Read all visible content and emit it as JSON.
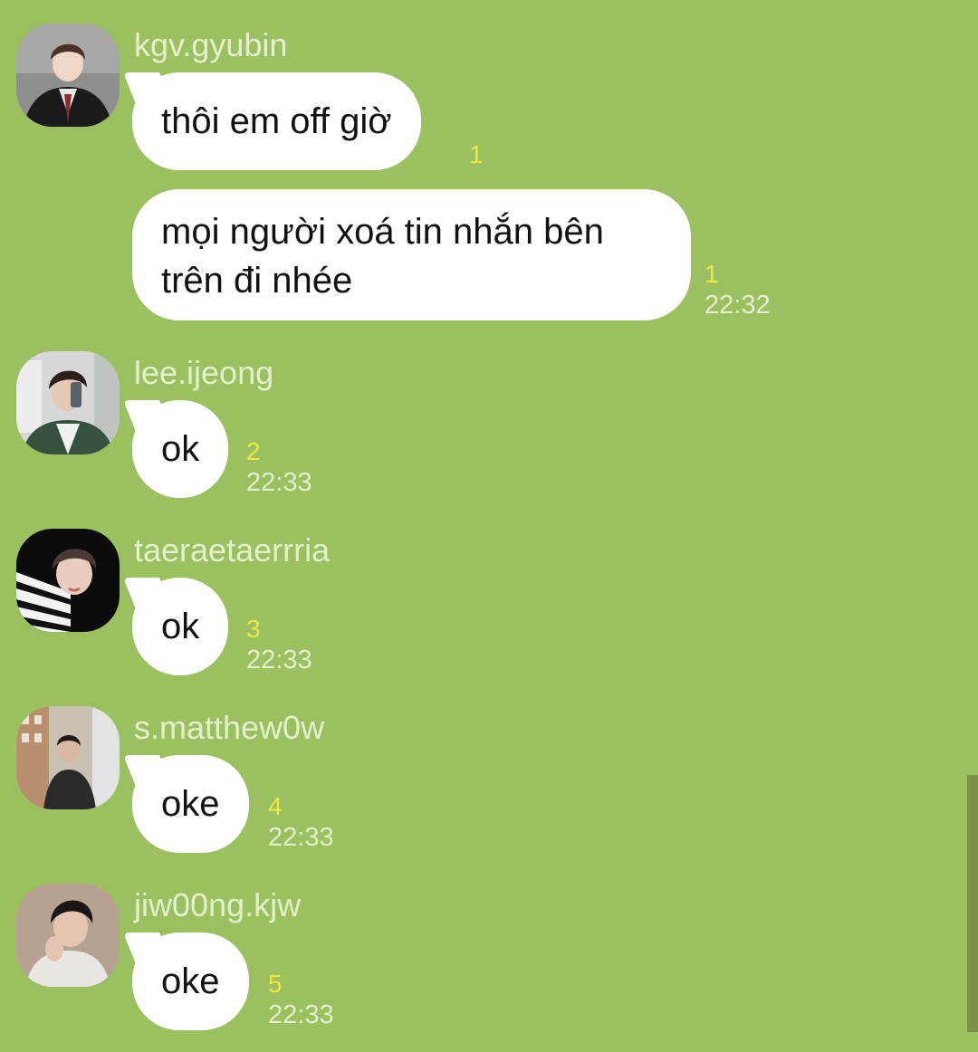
{
  "colors": {
    "background": "#9bc060",
    "bubble": "#ffffff",
    "read_count": "#f4e642",
    "muted_text": "#e4efcd",
    "scrollbar": "#7a9248"
  },
  "messages": [
    {
      "sender": "kgv.gyubin",
      "avatar": "avatar-photo",
      "items": [
        {
          "text": "thôi em off giờ",
          "read": "1",
          "time": ""
        },
        {
          "text": "mọi người xoá tin nhắn bên trên đi nhée",
          "read": "1",
          "time": "22:32"
        }
      ]
    },
    {
      "sender": "lee.ijeong",
      "avatar": "avatar-photo",
      "items": [
        {
          "text": "ok",
          "read": "2",
          "time": "22:33"
        }
      ]
    },
    {
      "sender": "taeraetaerrria",
      "avatar": "avatar-photo",
      "items": [
        {
          "text": "ok",
          "read": "3",
          "time": "22:33"
        }
      ]
    },
    {
      "sender": "s.matthew0w",
      "avatar": "avatar-photo",
      "items": [
        {
          "text": "oke",
          "read": "4",
          "time": "22:33"
        }
      ]
    },
    {
      "sender": "jiw00ng.kjw",
      "avatar": "avatar-photo",
      "items": [
        {
          "text": "oke",
          "read": "5",
          "time": "22:33"
        }
      ]
    }
  ]
}
